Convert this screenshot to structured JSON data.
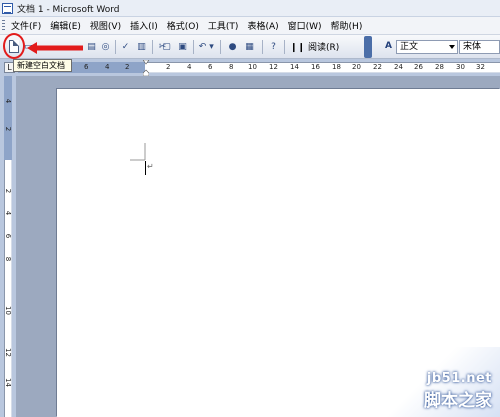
{
  "window": {
    "title": "文档 1 - Microsoft Word"
  },
  "menu": [
    "文件(F)",
    "编辑(E)",
    "视图(V)",
    "插入(I)",
    "格式(O)",
    "工具(T)",
    "表格(A)",
    "窗口(W)",
    "帮助(H)"
  ],
  "toolbar": {
    "read_label": "阅读(R)",
    "style_value": "正文",
    "style_icon": "A",
    "font_value": "宋体",
    "icons": [
      "new-document-icon",
      "open-icon",
      "save-icon",
      "print-icon",
      "print-preview-icon",
      "spelling-icon",
      "research-icon",
      "cut-icon",
      "copy-icon",
      "paste-icon",
      "undo-icon",
      "hyperlink-icon",
      "table-icon",
      "help-icon",
      "read-icon",
      "toolbar-options-icon"
    ]
  },
  "tooltip": {
    "text": "新建空白文档"
  },
  "ruler": {
    "tab_stop": "L",
    "h_numbers": [
      "8",
      "6",
      "4",
      "2",
      "2",
      "4",
      "6",
      "8",
      "10",
      "12",
      "14",
      "16",
      "18",
      "20",
      "22",
      "24",
      "26",
      "28",
      "30",
      "32",
      "34"
    ],
    "v_numbers": [
      "4",
      "2",
      "2",
      "4",
      "6",
      "8",
      "10",
      "12",
      "14"
    ]
  },
  "document": {
    "paragraph_mark": "↵"
  },
  "watermark": {
    "site": "jb51.net",
    "name": "脚本之家"
  },
  "colors": {
    "annotation_red": "#e21b1b",
    "ruler_blue": "#8ea4c8",
    "toolbar_blue": "#4b6ea8"
  }
}
